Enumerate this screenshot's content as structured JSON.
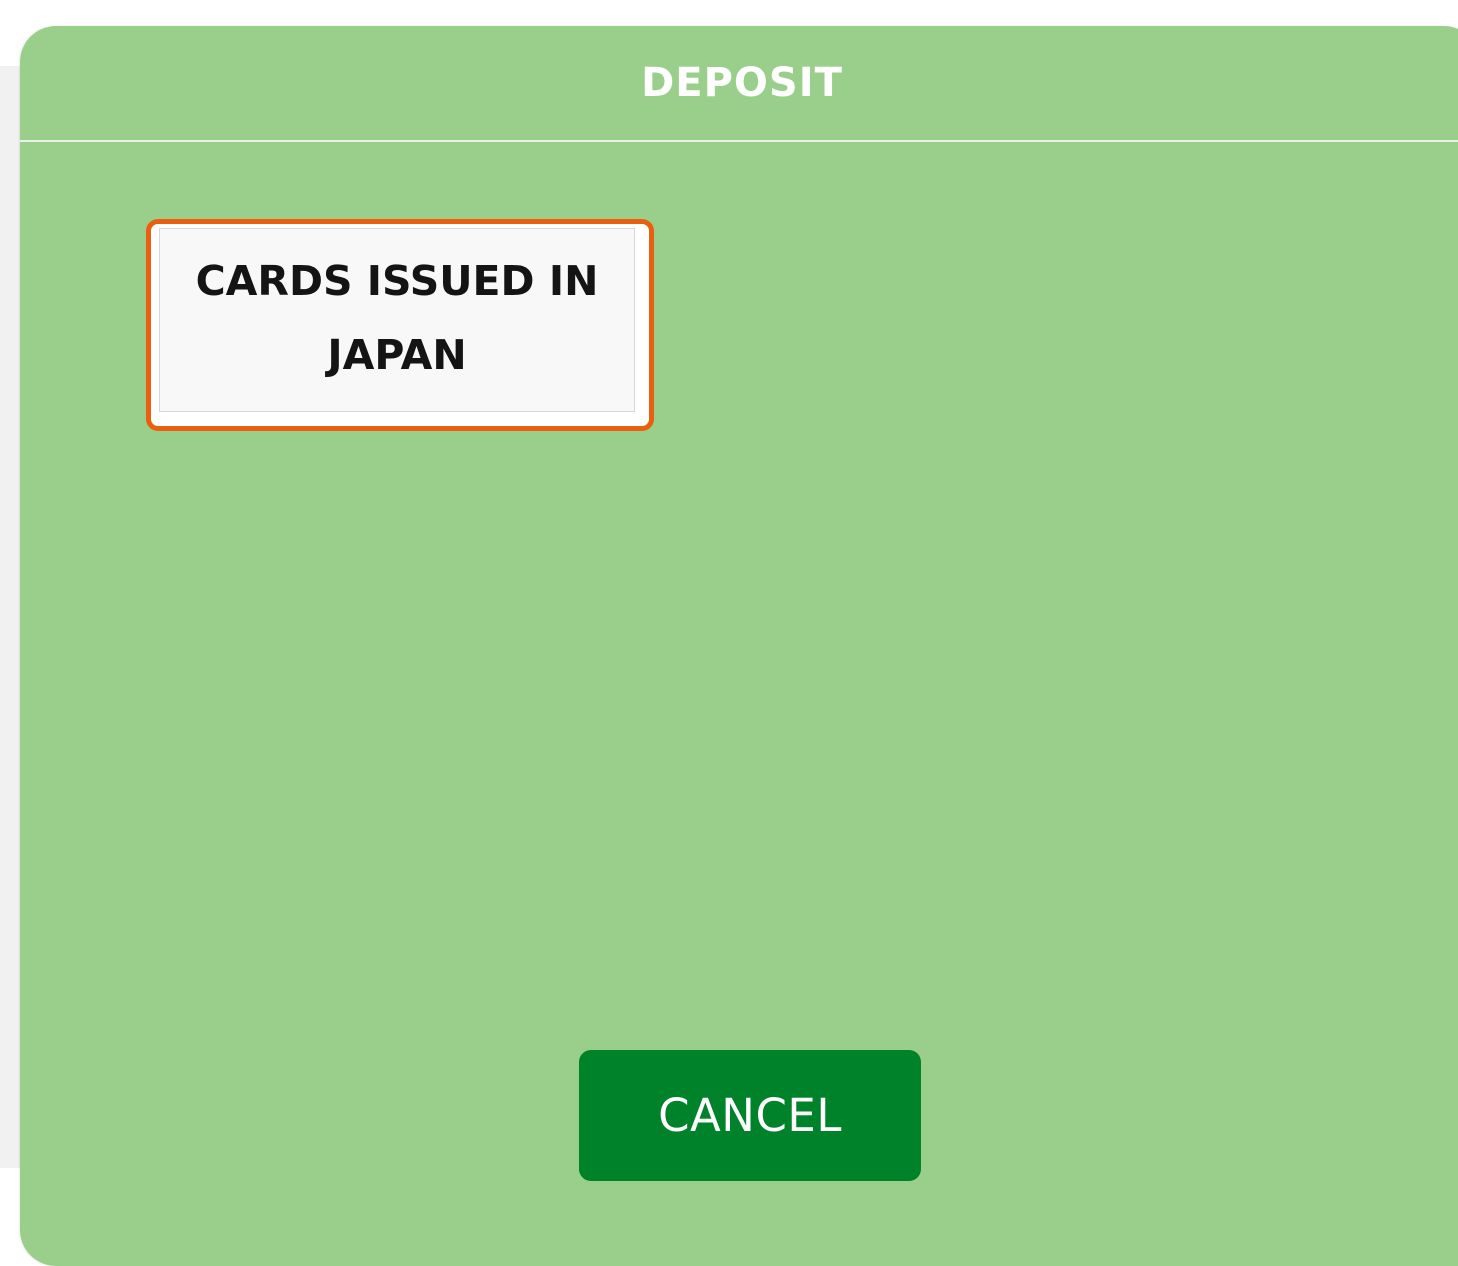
{
  "modal": {
    "title": "DEPOSIT",
    "options": [
      {
        "label": "CARDS ISSUED IN JAPAN",
        "selected": true
      }
    ],
    "cancel_label": "CANCEL"
  },
  "colors": {
    "modal_background": "#99cf8b",
    "selected_border": "#ea5f0f",
    "cancel_button": "#00822a",
    "title_text": "#ffffff"
  }
}
